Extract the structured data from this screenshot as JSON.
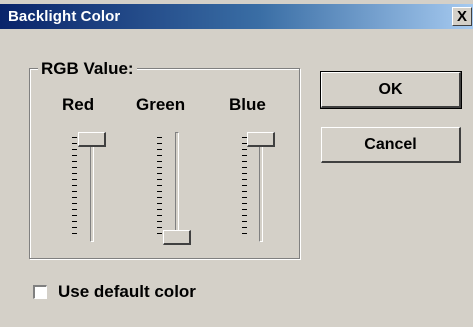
{
  "window": {
    "title": "Backlight Color",
    "close_glyph": "X"
  },
  "rgb_group": {
    "label": "RGB Value:",
    "channels": [
      {
        "name": "Red",
        "value": 0.0
      },
      {
        "name": "Green",
        "value": 1.0
      },
      {
        "name": "Blue",
        "value": 0.0
      }
    ]
  },
  "buttons": {
    "ok": "OK",
    "cancel": "Cancel"
  },
  "use_default": {
    "label": "Use default color",
    "checked": false
  },
  "colors": {
    "title_start": "#0a246a",
    "title_end": "#a6caf0",
    "face": "#d4d0c8"
  }
}
